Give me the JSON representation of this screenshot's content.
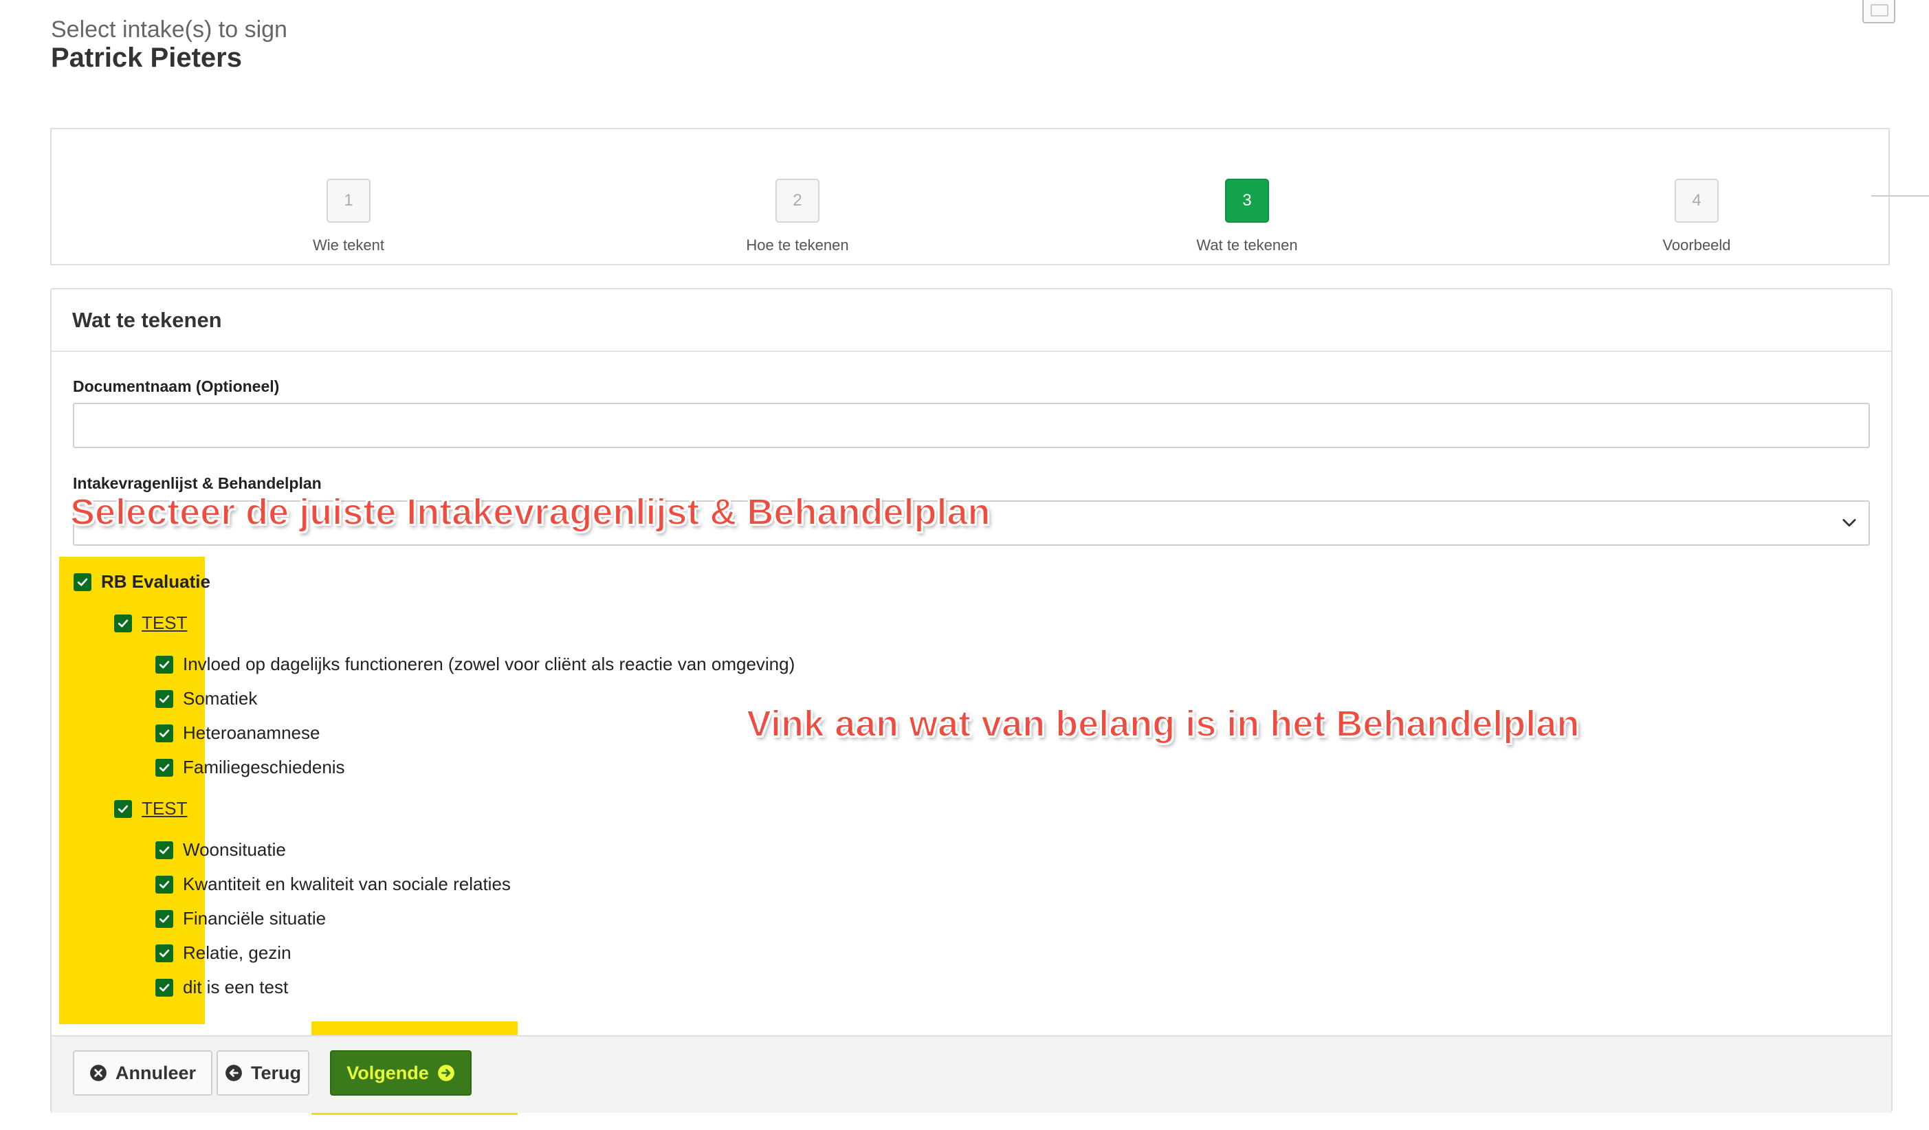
{
  "header": {
    "subtitle": "Select intake(s) to sign",
    "title": "Patrick Pieters"
  },
  "steps": [
    {
      "number": "1",
      "label": "Wie tekent",
      "active": false
    },
    {
      "number": "2",
      "label": "Hoe te tekenen",
      "active": false
    },
    {
      "number": "3",
      "label": "Wat te tekenen",
      "active": true
    },
    {
      "number": "4",
      "label": "Voorbeeld",
      "active": false
    }
  ],
  "panel": {
    "title": "Wat te tekenen",
    "document_name_label": "Documentnaam (Optioneel)",
    "document_name_value": "",
    "document_name_placeholder": "",
    "select_label": "Intakevragenlijst & Behandelplan",
    "select_value": ""
  },
  "tree": {
    "root": {
      "label": "RB Evaluatie",
      "checked": true
    },
    "groups": [
      {
        "label": "TEST",
        "checked": true,
        "items": [
          {
            "label": "Invloed op dagelijks functioneren (zowel voor cliënt als reactie van omgeving)",
            "checked": true
          },
          {
            "label": "Somatiek",
            "checked": true
          },
          {
            "label": "Heteroanamnese",
            "checked": true
          },
          {
            "label": "Familiegeschiedenis",
            "checked": true
          }
        ]
      },
      {
        "label": "TEST",
        "checked": true,
        "items": [
          {
            "label": "Woonsituatie",
            "checked": true
          },
          {
            "label": "Kwantiteit en kwaliteit van sociale relaties",
            "checked": true
          },
          {
            "label": "Financiële situatie",
            "checked": true
          },
          {
            "label": "Relatie, gezin",
            "checked": true
          },
          {
            "label": "dit is een test",
            "checked": true
          }
        ]
      }
    ]
  },
  "footer": {
    "cancel_label": "Annuleer",
    "back_label": "Terug",
    "next_label": "Volgende"
  },
  "annotations": {
    "select_hint": "Selecteer de juiste Intakevragenlijst & Behandelplan",
    "check_hint": "Vink aan wat van belang is in het Behandelplan"
  },
  "colors": {
    "active_step": "#12a34b",
    "checkbox": "#0b6e1f",
    "next_button_bg": "#3a7a1a",
    "next_button_text": "#e8ff3a",
    "highlight": "#ffdc00",
    "annotation_text": "#ef4b3f"
  },
  "icons": {
    "cancel": "x-circle-icon",
    "back": "arrow-left-circle-icon",
    "next": "arrow-right-circle-icon",
    "select": "chevron-down-icon",
    "checkbox": "checkmark-icon"
  }
}
